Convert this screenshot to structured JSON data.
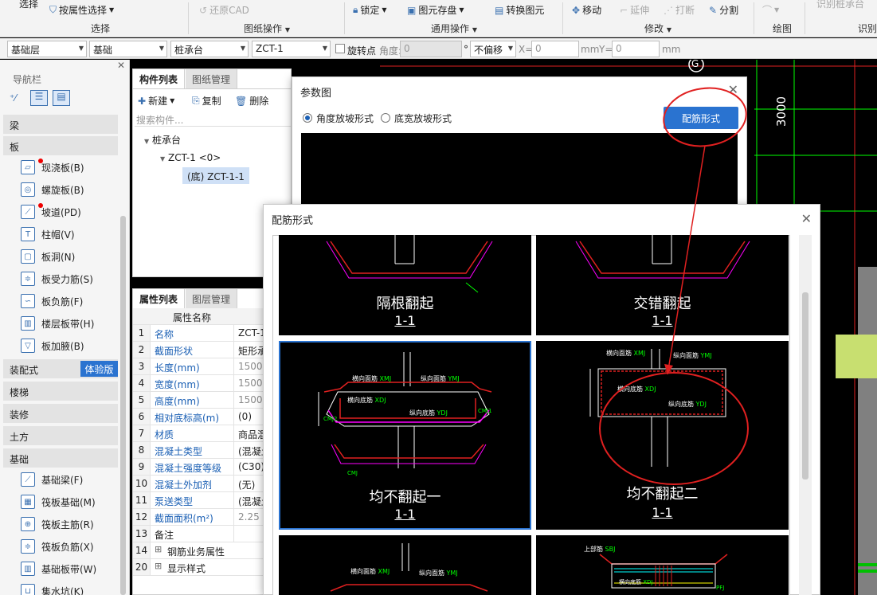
{
  "ribbon": {
    "top_items": {
      "select": "选择",
      "select_by_attr": "按属性选择",
      "restore_cad": "还原CAD",
      "lock": "锁定",
      "save_element": "图元存盘",
      "convert_element": "转换图元",
      "move": "移动",
      "extend": "延伸",
      "break": "打断",
      "split": "分割",
      "recognize_cap": "识别桩承台"
    },
    "groups": {
      "select": "选择",
      "drawing_ops": "图纸操作",
      "common_ops": "通用操作",
      "modify": "修改",
      "draw": "绘图",
      "recognize": "识别"
    }
  },
  "filter_bar": {
    "floor": "基础层",
    "category": "基础",
    "type": "桩承台",
    "component": "ZCT-1",
    "rotate_point_label": "旋转点",
    "angle_label": "角度:",
    "angle_value": "0",
    "degree": "°",
    "offset": "不偏移",
    "x_label": "X=",
    "x_value": "0",
    "mm1": "mm",
    "y_label": "Y=",
    "y_value": "0",
    "mm2": "mm"
  },
  "nav": {
    "title": "导航栏",
    "categories": {
      "beam": "梁",
      "slab": "板",
      "prefab": "装配式",
      "prefab_badge": "体验版",
      "stairs": "楼梯",
      "decoration": "装修",
      "earthwork": "土方",
      "foundation": "基础"
    },
    "slab_items": [
      "现浇板(B)",
      "螺旋板(B)",
      "坡道(PD)",
      "柱帽(V)",
      "板洞(N)",
      "板受力筋(S)",
      "板负筋(F)",
      "楼层板带(H)",
      "板加腋(B)"
    ],
    "foundation_items": [
      "基础梁(F)",
      "筏板基础(M)",
      "筏板主筋(R)",
      "筏板负筋(X)",
      "基础板带(W)",
      "集水坑(K)"
    ]
  },
  "component_list": {
    "tab_active": "构件列表",
    "tab_inactive": "图纸管理",
    "new": "新建",
    "copy": "复制",
    "delete": "删除",
    "search_placeholder": "搜索构件...",
    "tree_root": "桩承台",
    "tree_child": "ZCT-1 <0>",
    "tree_leaf": "(底) ZCT-1-1"
  },
  "property_list": {
    "tab_active": "属性列表",
    "tab_inactive": "图层管理",
    "header": "属性名称",
    "rows": [
      {
        "no": "1",
        "name": "名称",
        "value": "ZCT-1"
      },
      {
        "no": "2",
        "name": "截面形状",
        "value": "矩形承"
      },
      {
        "no": "3",
        "name": "长度(mm)",
        "value": "1500"
      },
      {
        "no": "4",
        "name": "宽度(mm)",
        "value": "1500"
      },
      {
        "no": "5",
        "name": "高度(mm)",
        "value": "1500"
      },
      {
        "no": "6",
        "name": "相对底标高(m)",
        "value": "(0)"
      },
      {
        "no": "7",
        "name": "材质",
        "value": "商品混"
      },
      {
        "no": "8",
        "name": "混凝土类型",
        "value": "(混凝土"
      },
      {
        "no": "9",
        "name": "混凝土强度等级",
        "value": "(C30)"
      },
      {
        "no": "10",
        "name": "混凝土外加剂",
        "value": "(无)"
      },
      {
        "no": "11",
        "name": "泵送类型",
        "value": "(混凝土"
      },
      {
        "no": "12",
        "name": "截面面积(m²)",
        "value": "2.25"
      },
      {
        "no": "13",
        "name": "备注",
        "value": ""
      },
      {
        "no": "14",
        "name": "钢筋业务属性",
        "value": ""
      },
      {
        "no": "20",
        "name": "显示样式",
        "value": ""
      }
    ]
  },
  "canvas": {
    "axis_label": "G",
    "dimension": "3000"
  },
  "param_dialog": {
    "title": "参数图",
    "radio_angle": "角度放坡形式",
    "radio_width": "底宽放坡形式",
    "button": "配筋形式"
  },
  "rebar_dialog": {
    "title": "配筋形式",
    "cells": [
      {
        "title": "隔根翻起",
        "section": "1-1"
      },
      {
        "title": "交错翻起",
        "section": "1-1"
      },
      {
        "title": "均不翻起一",
        "section": "1-1"
      },
      {
        "title": "均不翻起二",
        "section": "1-1"
      }
    ],
    "drawing_labels": {
      "top_horizontal": "横向面筋",
      "top_horizontal_code": "XMJ",
      "top_longitudinal": "纵向面筋",
      "top_longitudinal_code": "YMJ",
      "bottom_horizontal": "横向底筋",
      "bottom_horizontal_code": "XDJ",
      "bottom_longitudinal": "纵向底筋",
      "bottom_longitudinal_code": "YDJ",
      "top_rebar": "上部筋",
      "top_rebar_code": "SBJ",
      "side_code_1": "CMJ1",
      "side_code_2": "CMJ2",
      "side_code_3": "CMJ",
      "top_code": "XMJ",
      "bottom_code": "XDJ",
      "extra_code": "YMJ",
      "far_code": "PFJ"
    }
  },
  "colors": {
    "accent": "#2a73d0",
    "annotation": "#e02020",
    "cad_red": "#e02020",
    "cad_green": "#00ff00",
    "cad_magenta": "#ff00ff"
  }
}
